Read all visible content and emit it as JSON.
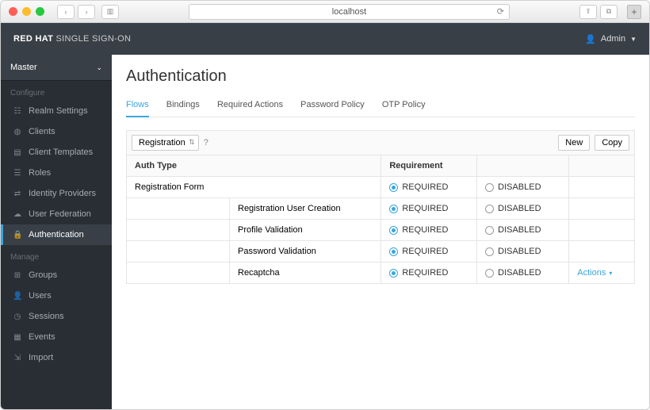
{
  "browser": {
    "url": "localhost"
  },
  "app": {
    "brand_bold": "RED HAT",
    "brand_thin": "SINGLE SIGN-ON",
    "user_label": "Admin"
  },
  "sidebar": {
    "realm": "Master",
    "section_configure": "Configure",
    "section_manage": "Manage",
    "items_configure": [
      {
        "label": "Realm Settings"
      },
      {
        "label": "Clients"
      },
      {
        "label": "Client Templates"
      },
      {
        "label": "Roles"
      },
      {
        "label": "Identity Providers"
      },
      {
        "label": "User Federation"
      },
      {
        "label": "Authentication"
      }
    ],
    "items_manage": [
      {
        "label": "Groups"
      },
      {
        "label": "Users"
      },
      {
        "label": "Sessions"
      },
      {
        "label": "Events"
      },
      {
        "label": "Import"
      }
    ]
  },
  "page": {
    "title": "Authentication",
    "tabs": [
      {
        "label": "Flows"
      },
      {
        "label": "Bindings"
      },
      {
        "label": "Required Actions"
      },
      {
        "label": "Password Policy"
      },
      {
        "label": "OTP Policy"
      }
    ],
    "select_value": "Registration",
    "btn_new": "New",
    "btn_copy": "Copy",
    "th_auth": "Auth Type",
    "th_req": "Requirement",
    "req_required": "REQUIRED",
    "req_disabled": "DISABLED",
    "actions_label": "Actions",
    "rows": [
      {
        "label": "Registration Form",
        "indent": 0,
        "actions": false
      },
      {
        "label": "Registration User Creation",
        "indent": 1,
        "actions": false
      },
      {
        "label": "Profile Validation",
        "indent": 1,
        "actions": false
      },
      {
        "label": "Password Validation",
        "indent": 1,
        "actions": false
      },
      {
        "label": "Recaptcha",
        "indent": 1,
        "actions": true
      }
    ]
  }
}
